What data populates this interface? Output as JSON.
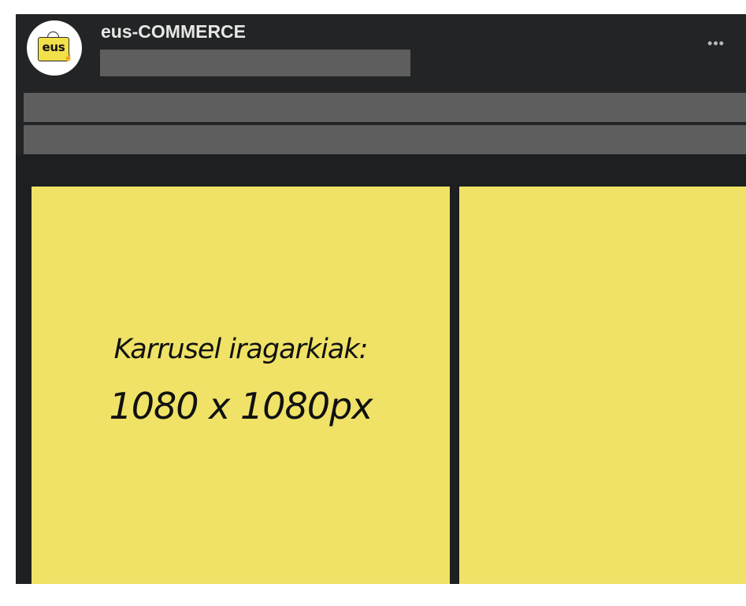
{
  "post": {
    "page_name": "eus-COMMERCE",
    "logo_text": "eus",
    "more_icon": "ellipsis-horizontal-icon",
    "more_glyph": "•••"
  },
  "carousel": {
    "cards": [
      {
        "line1": "Karrusel iragarkiak:",
        "line2": "1080 x 1080px",
        "background": "#efe266"
      },
      {
        "background": "#efe266"
      }
    ]
  },
  "colors": {
    "post_background": "#222425",
    "media_background": "#1d1f20",
    "card_yellow": "#efe266",
    "redaction_gray": "#5e5e5e",
    "name_text": "#e7e7e7"
  }
}
